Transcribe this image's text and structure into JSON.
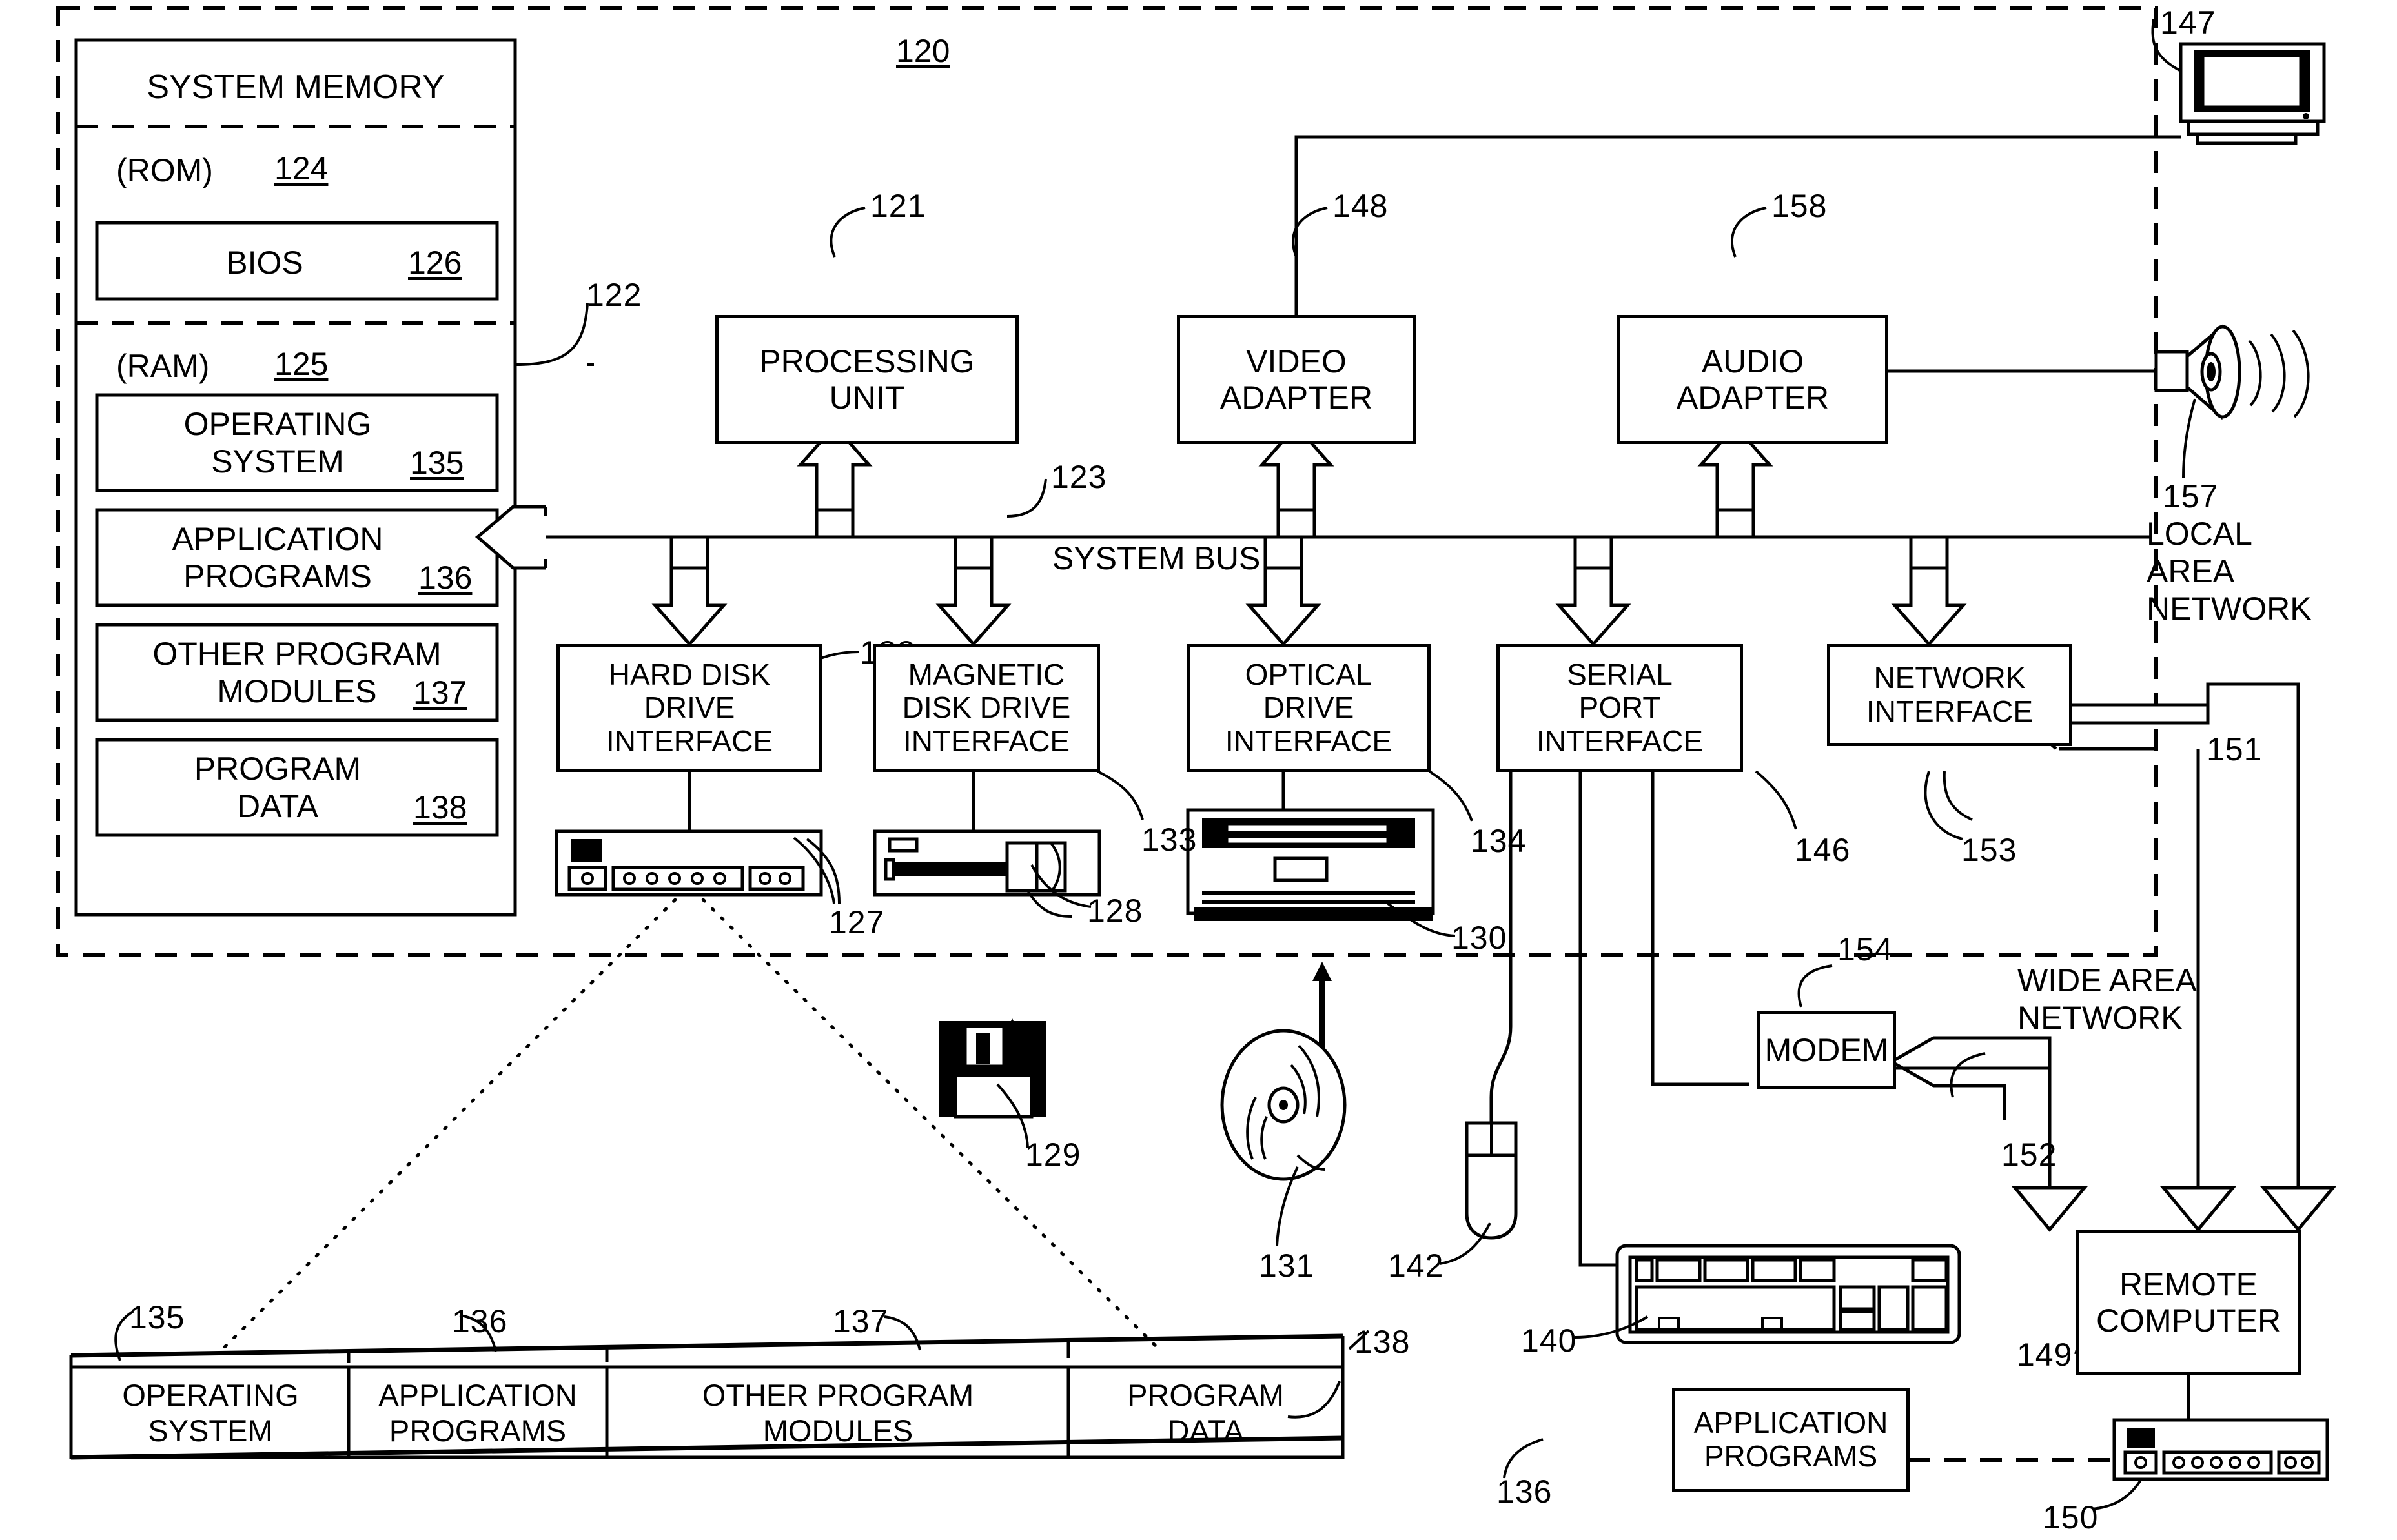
{
  "figure": {
    "main_ref": "120",
    "system_bus_label": "SYSTEM BUS",
    "local_area_network": "LOCAL\nAREA\nNETWORK",
    "wide_area_network": "WIDE AREA\nNETWORK"
  },
  "system_memory": {
    "title": "SYSTEM MEMORY",
    "memory_bus_ref": "122",
    "rom": {
      "label": "(ROM)",
      "ref": "124"
    },
    "bios": {
      "label": "BIOS",
      "ref": "126"
    },
    "ram": {
      "label": "(RAM)",
      "ref": "125"
    },
    "modules": [
      {
        "line1": "OPERATING",
        "line2": "SYSTEM",
        "ref": "135"
      },
      {
        "line1": "APPLICATION",
        "line2": "PROGRAMS",
        "ref": "136"
      },
      {
        "line1": "OTHER PROGRAM",
        "line2": "MODULES",
        "ref": "137"
      },
      {
        "line1": "PROGRAM",
        "line2": "DATA",
        "ref": "138"
      }
    ]
  },
  "core": {
    "processing_unit": {
      "line1": "PROCESSING",
      "line2": "UNIT",
      "ref": "121"
    },
    "system_bus_ref": "123",
    "video_adapter": {
      "line1": "VIDEO",
      "line2": "ADAPTER",
      "ref": "148"
    },
    "audio_adapter": {
      "line1": "AUDIO",
      "line2": "ADAPTER",
      "ref": "158"
    }
  },
  "interfaces": [
    {
      "line1": "HARD DISK",
      "line2": "DRIVE",
      "line3": "INTERFACE",
      "ref": "132"
    },
    {
      "line1": "MAGNETIC",
      "line2": "DISK DRIVE",
      "line3": "INTERFACE",
      "ref": "133"
    },
    {
      "line1": "OPTICAL",
      "line2": "DRIVE",
      "line3": "INTERFACE",
      "ref": "134"
    },
    {
      "line1": "SERIAL",
      "line2": "PORT",
      "line3": "INTERFACE",
      "ref": "146"
    },
    {
      "line1": "NETWORK",
      "line2": "INTERFACE",
      "line3": "",
      "ref": "153"
    }
  ],
  "devices": {
    "hard_drive_ref": "127",
    "floppy_drive_ref": "128",
    "optical_drive_ref": "130",
    "floppy_disk_ref": "129",
    "optical_disc_ref": "131",
    "mouse_ref": "142",
    "keyboard_ref": "140",
    "monitor_ref": "147",
    "speaker_ref": "157"
  },
  "network": {
    "lan_ref": "151",
    "wan_ref": "152",
    "modem": {
      "label": "MODEM",
      "ref": "154"
    },
    "remote_computer": {
      "line1": "REMOTE",
      "line2": "COMPUTER",
      "ref": "149"
    },
    "remote_storage_ref": "150",
    "remote_apps": {
      "line1": "APPLICATION",
      "line2": "PROGRAMS",
      "ref": "136"
    }
  },
  "bottom_strip": {
    "cells": [
      {
        "line1": "OPERATING",
        "line2": "SYSTEM",
        "ref": "135"
      },
      {
        "line1": "APPLICATION",
        "line2": "PROGRAMS",
        "ref": "136"
      },
      {
        "line1": "OTHER PROGRAM",
        "line2": "MODULES",
        "ref": "137"
      },
      {
        "line1": "PROGRAM",
        "line2": "DATA",
        "ref": "138"
      }
    ]
  },
  "colors": {
    "ink": "#000000",
    "paper": "#ffffff"
  }
}
